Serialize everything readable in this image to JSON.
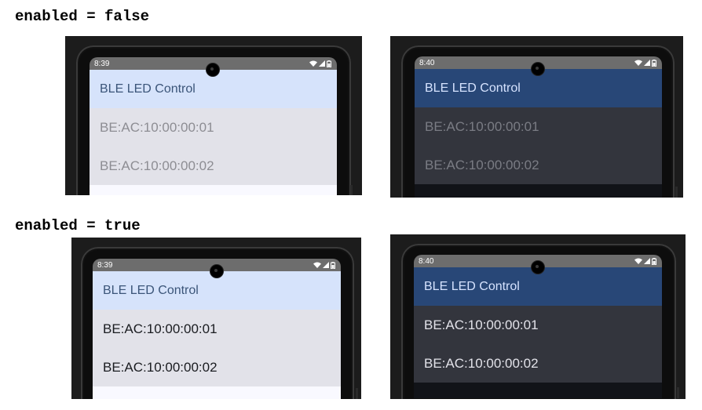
{
  "sections": [
    {
      "heading": "enabled = false",
      "phones": [
        {
          "theme": "light",
          "time": "8:39",
          "app_title": "BLE LED Control",
          "devices": [
            "BE:AC:10:00:00:01",
            "BE:AC:10:00:00:02"
          ]
        },
        {
          "theme": "dark",
          "time": "8:40",
          "app_title": "BLE LED Control",
          "devices": [
            "BE:AC:10:00:00:01",
            "BE:AC:10:00:00:02"
          ]
        }
      ]
    },
    {
      "heading": "enabled = true",
      "phones": [
        {
          "theme": "light",
          "time": "8:39",
          "app_title": "BLE LED Control",
          "devices": [
            "BE:AC:10:00:00:01",
            "BE:AC:10:00:00:02"
          ]
        },
        {
          "theme": "dark",
          "time": "8:40",
          "app_title": "BLE LED Control",
          "devices": [
            "BE:AC:10:00:00:01",
            "BE:AC:10:00:00:02"
          ]
        }
      ]
    }
  ],
  "icons": {
    "wifi": "wifi-icon",
    "signal": "cell-signal-icon",
    "battery": "battery-icon",
    "camera": "front-camera-icon"
  },
  "colors": {
    "light_appbar": "#d6e3fb",
    "light_list": "#e2e2e9",
    "dark_appbar": "#284777",
    "dark_list": "#33353d"
  }
}
